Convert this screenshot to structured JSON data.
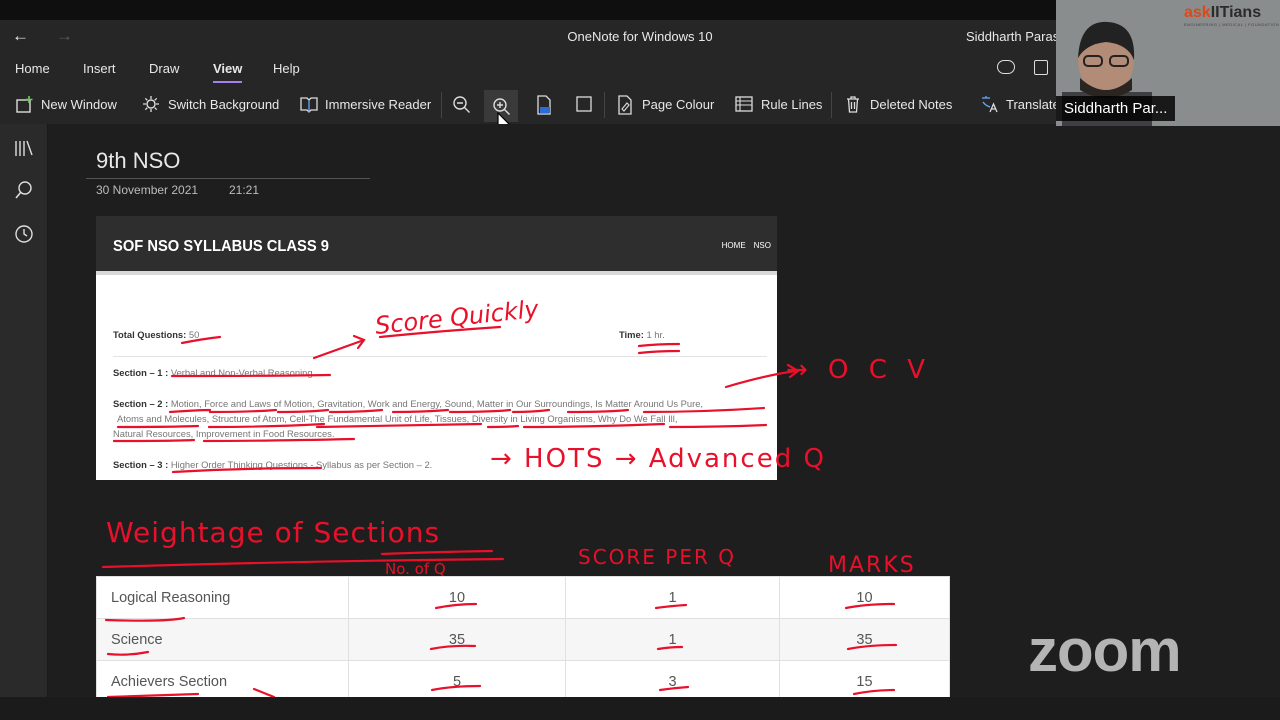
{
  "window": {
    "title": "OneNote for Windows 10",
    "user": "Siddharth Paras"
  },
  "menu": {
    "tabs": [
      "Home",
      "Insert",
      "Draw",
      "View",
      "Help"
    ],
    "active_tab": "View"
  },
  "ribbon": {
    "new_window": "New Window",
    "switch_background": "Switch Background",
    "immersive_reader": "Immersive Reader",
    "page_colour": "Page Colour",
    "rule_lines": "Rule Lines",
    "deleted_notes": "Deleted Notes",
    "translate": "Translate"
  },
  "page": {
    "title": "9th NSO",
    "date": "30 November 2021",
    "time": "21:21"
  },
  "syllabus": {
    "heading": "SOF NSO SYLLABUS CLASS 9",
    "nav": [
      "HOME",
      "NSO"
    ],
    "total_questions_label": "Total Questions:",
    "total_questions_value": "50",
    "time_label": "Time:",
    "time_value": "1 hr.",
    "section1_label": "Section – 1 :",
    "section1_value": "Verbal and Non-Verbal Reasoning",
    "section2_label": "Section – 2 :",
    "section2_line1": "Motion, Force and Laws of Motion, Gravitation, Work and Energy, Sound, Matter in Our Surroundings, Is Matter Around Us Pure,",
    "section2_line2": "Atoms and Molecules, Structure of Atom, Cell-The Fundamental Unit of Life, Tissues, Diversity in Living Organisms, Why Do We Fall Ill,",
    "section2_line3": "Natural Resources, Improvement in Food Resources.",
    "section3_label": "Section – 3 :",
    "section3_value": "Higher Order Thinking Questions",
    "section3_rest": "- Syllabus as per Section – 2."
  },
  "weightage_table": {
    "rows": [
      [
        "Logical Reasoning",
        "10",
        "1",
        "10"
      ],
      [
        "Science",
        "35",
        "1",
        "35"
      ],
      [
        "Achievers Section",
        "5",
        "3",
        "15"
      ]
    ]
  },
  "handwriting": {
    "score_quickly": "Score Quickly",
    "ocv": "→ O C V",
    "hots": "→ HOTS → Advanced Q",
    "weightage": "Weightage of Sections",
    "no_of_q": "No. of Q",
    "score_per_q": "SCORE PER Q",
    "marks": "MARKS"
  },
  "webcam": {
    "name_label": "Siddharth Par...",
    "logo_prefix": "ask",
    "logo_suffix": "IITians",
    "logo_tagline": "ENGINEERING | MEDICAL | FOUNDATION"
  },
  "watermark": "zoom"
}
